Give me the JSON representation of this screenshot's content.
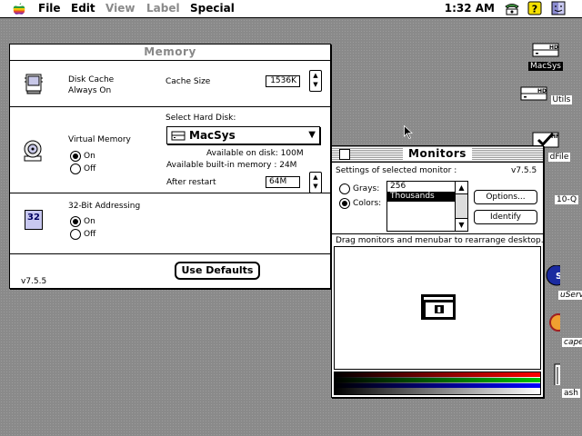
{
  "menubar": {
    "items": [
      {
        "label": "File",
        "enabled": true
      },
      {
        "label": "Edit",
        "enabled": true
      },
      {
        "label": "View",
        "enabled": false
      },
      {
        "label": "Label",
        "enabled": false
      },
      {
        "label": "Special",
        "enabled": true
      }
    ],
    "clock": "1:32 AM",
    "tray_icons": [
      "phone-icon",
      "help-icon",
      "finder-icon"
    ]
  },
  "memory": {
    "title": "Memory",
    "disk_cache": {
      "label_line1": "Disk Cache",
      "label_line2": "Always On",
      "cache_size_label": "Cache Size",
      "cache_size_value": "1536K"
    },
    "virtual_memory": {
      "select_label": "Select Hard Disk:",
      "label": "Virtual Memory",
      "options": [
        "On",
        "Off"
      ],
      "selected": "On",
      "disk_popup_value": "MacSys",
      "available_disk": "Available on disk:  100M",
      "available_builtin": "Available built-in memory :  24M",
      "after_restart_label": "After restart",
      "after_restart_value": "64M"
    },
    "addressing": {
      "label": "32-Bit Addressing",
      "icon_text": "32",
      "options": [
        "On",
        "Off"
      ],
      "selected": "On"
    },
    "version": "v7.5.5",
    "use_defaults_label": "Use Defaults"
  },
  "monitors": {
    "title": "Monitors",
    "settings_label": "Settings of selected monitor :",
    "version": "v7.5.5",
    "grays_label": "Grays:",
    "colors_label": "Colors:",
    "selected_mode": "Colors",
    "depth_list": [
      "256",
      "Thousands"
    ],
    "selected_depth": "Thousands",
    "options_label": "Options...",
    "identify_label": "Identify",
    "drag_hint": "Drag monitors and menubar to rearrange desktop."
  },
  "desktop_icons": [
    {
      "label": "MacSys",
      "selected": true,
      "icon": "hard-disk-icon",
      "badge": "HD"
    },
    {
      "label": "Utils",
      "selected": false,
      "icon": "hard-disk-icon",
      "badge": "HD"
    },
    {
      "label": "dFile",
      "selected": false,
      "icon": "hfs-disk-icon",
      "badge": "HF"
    },
    {
      "label": "10-Q",
      "selected": false,
      "icon": "generic-icon"
    },
    {
      "label": "uServe",
      "selected": false,
      "icon": "globe-icon"
    },
    {
      "label": "cape",
      "selected": false,
      "icon": "netscape-icon"
    },
    {
      "label": "ash",
      "selected": false,
      "icon": "trash-icon"
    }
  ],
  "colors": {
    "desktop": "#8a8a8a",
    "window_bg": "#ffffff",
    "selection": "#000000"
  }
}
